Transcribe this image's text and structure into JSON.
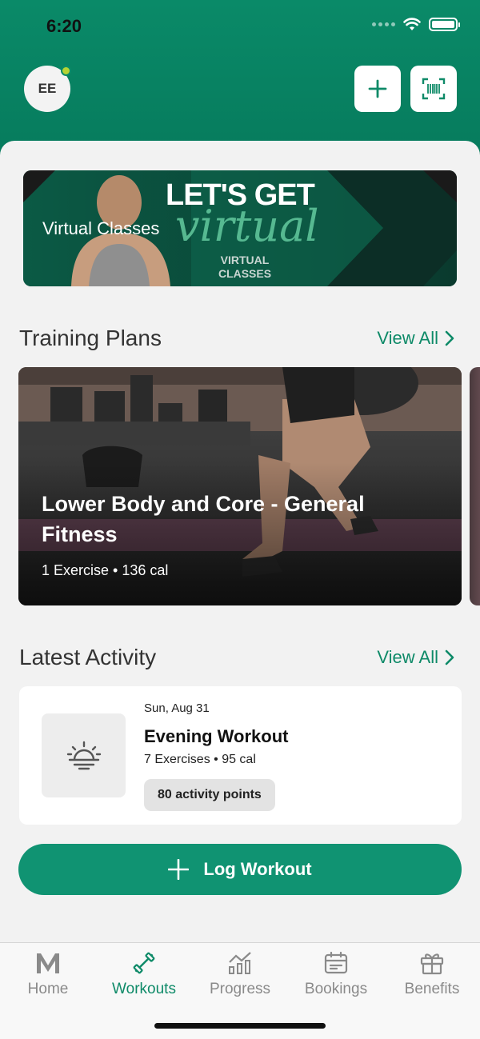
{
  "status_bar": {
    "time": "6:20"
  },
  "header": {
    "avatar_initials": "EE",
    "add_icon": "plus-icon",
    "scan_icon": "barcode-scan-icon"
  },
  "banner": {
    "label": "Virtual Classes",
    "headline": "LET'S GET",
    "script_text": "virtual",
    "sub_text_line1": "VIRTUAL",
    "sub_text_line2": "CLASSES"
  },
  "training_plans": {
    "title": "Training Plans",
    "view_all": "View All",
    "cards": [
      {
        "title": "Lower Body and Core - General Fitness",
        "meta": "1 Exercise • 136 cal"
      }
    ]
  },
  "latest_activity": {
    "title": "Latest Activity",
    "view_all": "View All",
    "item": {
      "date": "Sun, Aug 31",
      "title": "Evening Workout",
      "meta": "7 Exercises • 95 cal",
      "points": "80 activity points",
      "icon": "sunset-icon"
    }
  },
  "log_button": {
    "label": "Log Workout"
  },
  "tabbar": {
    "items": [
      {
        "label": "Home",
        "icon": "m-logo-icon",
        "active": false
      },
      {
        "label": "Workouts",
        "icon": "dumbbell-icon",
        "active": true
      },
      {
        "label": "Progress",
        "icon": "chart-icon",
        "active": false
      },
      {
        "label": "Bookings",
        "icon": "calendar-icon",
        "active": false
      },
      {
        "label": "Benefits",
        "icon": "gift-icon",
        "active": false
      }
    ]
  },
  "colors": {
    "brand_green": "#0a8a68",
    "accent_dot": "#b5d334",
    "button_green": "#109372",
    "inactive_gray": "#8a8a8a"
  }
}
